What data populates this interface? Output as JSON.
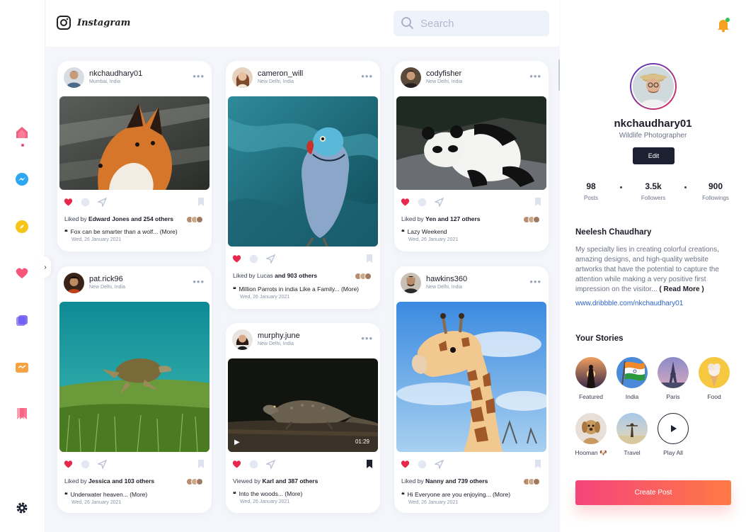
{
  "brand": {
    "name": "Instagram"
  },
  "search": {
    "placeholder": "Search"
  },
  "sidebar": {
    "items": [
      {
        "name": "home-icon",
        "color": "#f0466a"
      },
      {
        "name": "messenger-icon",
        "color": "#2da8f0"
      },
      {
        "name": "explore-icon",
        "color": "#f5c518"
      },
      {
        "name": "activity-icon",
        "color": "#f5567a"
      },
      {
        "name": "layers-icon",
        "color": "#6a5cf0"
      },
      {
        "name": "chat-icon",
        "color": "#f5a445"
      },
      {
        "name": "saved-icon",
        "color": "#f5567a"
      },
      {
        "name": "settings-icon",
        "color": "#1c2030"
      }
    ],
    "collapse_glyph": "›"
  },
  "posts": [
    {
      "user": "nkchaudhary01",
      "location": "Mumbai, India",
      "liked_prefix": "Liked by",
      "liked_names": "Edward Jones and 254 others",
      "caption": "Fox can be smarter than a wolf... (More)",
      "date": "Wed, 26 January 2021",
      "scene": "fox"
    },
    {
      "user": "cameron_will",
      "location": "New Delhi, India",
      "liked_prefix": "Liked by",
      "liked_names": "Lucas",
      "liked_suffix": "and 903 others",
      "caption": "Million Parrots in india Like a Family... (More)",
      "date": "Wed, 26 January 2021",
      "scene": "parrot"
    },
    {
      "user": "codyfisher",
      "location": "New Delhi, India",
      "liked_prefix": "Liked by",
      "liked_names": "Yen and 127 others",
      "caption": "Lazy Weekend",
      "date": "Wed, 26 January 2021",
      "scene": "panda"
    },
    {
      "user": "pat.rick96",
      "location": "New Delhi, India",
      "liked_prefix": "Liked by",
      "liked_names": "Jessica and 103 others",
      "caption": "Underwater heaven... (More)",
      "date": "Wed, 26 January 2021",
      "scene": "turtle"
    },
    {
      "user": "murphy.june",
      "location": "New Delhi, India",
      "liked_prefix": "Viewed by",
      "liked_names": "Karl and 387 others",
      "caption": "Into the woods... (More)",
      "date": "Wed, 26 January 2021",
      "scene": "lizard",
      "video_time": "01:29"
    },
    {
      "user": "hawkins360",
      "location": "New Delhi, India",
      "liked_prefix": "Liked by",
      "liked_names": "Nanny and 739 others",
      "caption": "Hi Everyone are you enjoying... (More)",
      "date": "Wed, 26 January 2021",
      "scene": "giraffe"
    }
  ],
  "profile": {
    "username": "nkchaudhary01",
    "role": "Wildlife Photographer",
    "edit_label": "Edit",
    "stats": [
      {
        "value": "98",
        "label": "Posts"
      },
      {
        "value": "3.5k",
        "label": "Followers"
      },
      {
        "value": "900",
        "label": "Followings"
      }
    ],
    "full_name": "Neelesh Chaudhary",
    "bio": "My specialty lies in creating colorful creations, amazing designs, and high-quality website artworks that have the potential to capture the attention while making a very positive first impression on the visitor...",
    "bio_more": "( Read More )",
    "website": "www.dribbble.com/nkchaudhary01"
  },
  "stories": {
    "title": "Your Stories",
    "items": [
      {
        "label": "Featured"
      },
      {
        "label": "India"
      },
      {
        "label": "Paris"
      },
      {
        "label": "Food"
      },
      {
        "label": "Hooman 🐶"
      },
      {
        "label": "Travel"
      },
      {
        "label": "Play All"
      }
    ]
  },
  "create_post_label": "Create Post",
  "colors": {
    "accent": "#f5447a",
    "accent2": "#ff7a45",
    "like": "#e8284a",
    "dark": "#1c2030"
  }
}
